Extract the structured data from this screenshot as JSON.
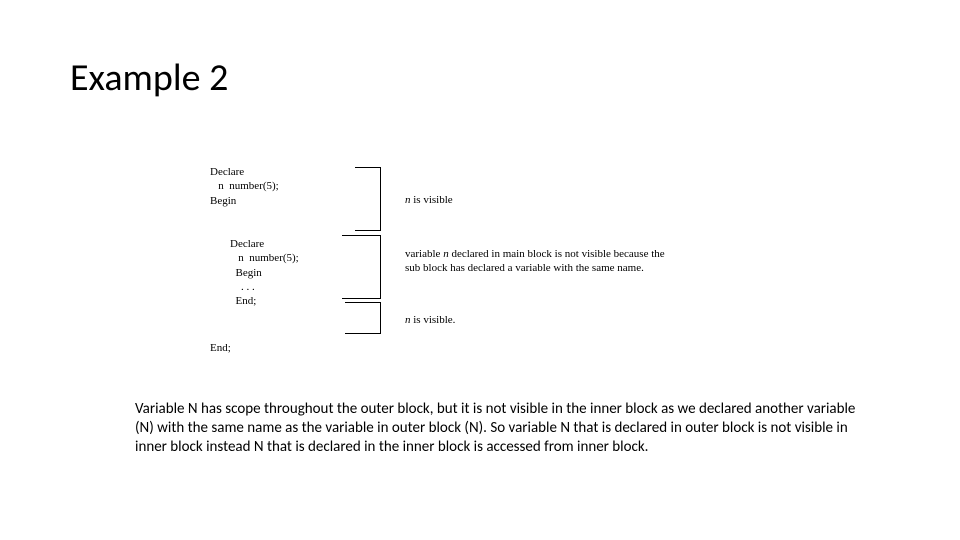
{
  "title": "Example 2",
  "code": {
    "outer_top": "Declare\n   n  number(5);\nBegin",
    "inner": "Declare\n   n  number(5);\n  Begin\n    . . .\n  End;",
    "outer_bottom": "End;"
  },
  "ann": {
    "a1_n": "n",
    "a1_rest": "  is visible",
    "a2_pre": "variable ",
    "a2_n": "n",
    "a2_post": "  declared in main block is not visible because the sub block has declared  a variable with the same name.",
    "a3_n": "n",
    "a3_rest": " is visible."
  },
  "body": "Variable N  has scope throughout the outer block, but it is not visible in the inner block as we declared another variable (N) with the same name as the variable in outer block (N). So variable N that is declared in outer block is not visible in inner block instead N that is declared in the inner block is accessed from inner block."
}
